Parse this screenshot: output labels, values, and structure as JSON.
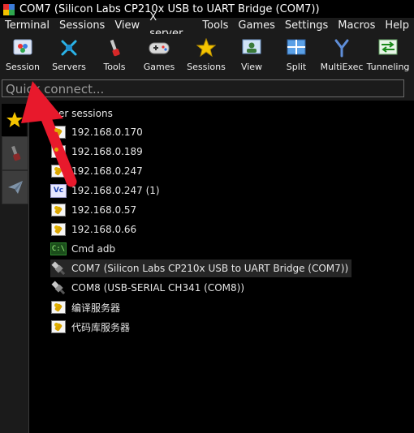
{
  "window": {
    "title": "COM7  (Silicon Labs CP210x USB to UART Bridge (COM7))"
  },
  "menu": [
    "Terminal",
    "Sessions",
    "View",
    "X server",
    "Tools",
    "Games",
    "Settings",
    "Macros",
    "Help"
  ],
  "toolbar": [
    {
      "label": "Session",
      "icon": "session-icon"
    },
    {
      "label": "Servers",
      "icon": "servers-icon"
    },
    {
      "label": "Tools",
      "icon": "tools-icon"
    },
    {
      "label": "Games",
      "icon": "games-icon"
    },
    {
      "label": "Sessions",
      "icon": "sessions-star-icon"
    },
    {
      "label": "View",
      "icon": "view-icon"
    },
    {
      "label": "Split",
      "icon": "split-icon"
    },
    {
      "label": "MultiExec",
      "icon": "multiexec-icon"
    },
    {
      "label": "Tunneling",
      "icon": "tunneling-icon"
    }
  ],
  "quick_connect": {
    "placeholder": "Quick connect..."
  },
  "tree": {
    "root_label": "User sessions",
    "items": [
      {
        "label": "192.168.0.170",
        "icon": "ssh-key-icon"
      },
      {
        "label": "192.168.0.189",
        "icon": "ssh-key-icon"
      },
      {
        "label": "192.168.0.247",
        "icon": "ssh-key-icon"
      },
      {
        "label": "192.168.0.247 (1)",
        "icon": "vnc-icon",
        "icon_text": "Vc"
      },
      {
        "label": "192.168.0.57",
        "icon": "ssh-key-icon"
      },
      {
        "label": "192.168.0.66",
        "icon": "ssh-key-icon"
      },
      {
        "label": "Cmd adb",
        "icon": "cmd-icon",
        "icon_text": "C:\\"
      },
      {
        "label": "COM7  (Silicon Labs CP210x USB to UART Bridge (COM7))",
        "icon": "serial-plug-icon",
        "selected": true
      },
      {
        "label": "COM8  (USB-SERIAL CH341 (COM8))",
        "icon": "serial-plug-icon"
      },
      {
        "label": "编译服务器",
        "icon": "ssh-key-icon"
      },
      {
        "label": "代码库服务器",
        "icon": "ssh-key-icon"
      }
    ]
  },
  "colors": {
    "accent": "#e8192c",
    "selection": "#262626",
    "star": "#f5c400"
  }
}
